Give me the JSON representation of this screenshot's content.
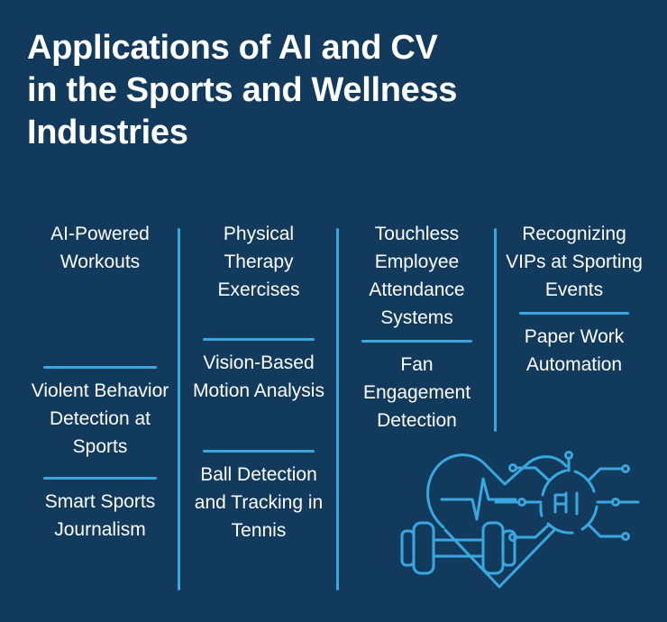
{
  "theme": {
    "background": "#123a5c",
    "accent": "#3aa8e0",
    "text": "#ffffff",
    "illustration_stroke": "#3aa8e0"
  },
  "header": {
    "title_lines": [
      "Applications of AI and CV",
      "in the Sports and Wellness",
      "Industries"
    ],
    "title_full": "Applications of AI and CV in the Sports and Wellness Industries"
  },
  "columns": [
    {
      "id": "column-1",
      "items": [
        {
          "label": "AI-Powered Workouts"
        },
        {
          "label": "Violent Behavior Detection at Sports"
        },
        {
          "label": "Smart Sports Journalism"
        }
      ]
    },
    {
      "id": "column-2",
      "items": [
        {
          "label": "Physical Therapy Exercises"
        },
        {
          "label": "Vision-Based Motion Analysis"
        },
        {
          "label": "Ball Detection and Tracking in Tennis"
        }
      ]
    },
    {
      "id": "column-3",
      "items": [
        {
          "label": "Touchless Employee Attendance Systems"
        },
        {
          "label": "Fan Engagement Detection"
        }
      ]
    },
    {
      "id": "column-4",
      "items": [
        {
          "label": "Recognizing VIPs at Sporting Events"
        },
        {
          "label": "Paper Work Automation"
        }
      ]
    }
  ],
  "illustration": {
    "name": "heart-ecg-dumbbell-ai-circuit-illustration",
    "badge_text": "AI",
    "elements": [
      "heart-outline",
      "ecg-heartbeat-line",
      "dumbbell",
      "ai-circuit-node"
    ]
  }
}
